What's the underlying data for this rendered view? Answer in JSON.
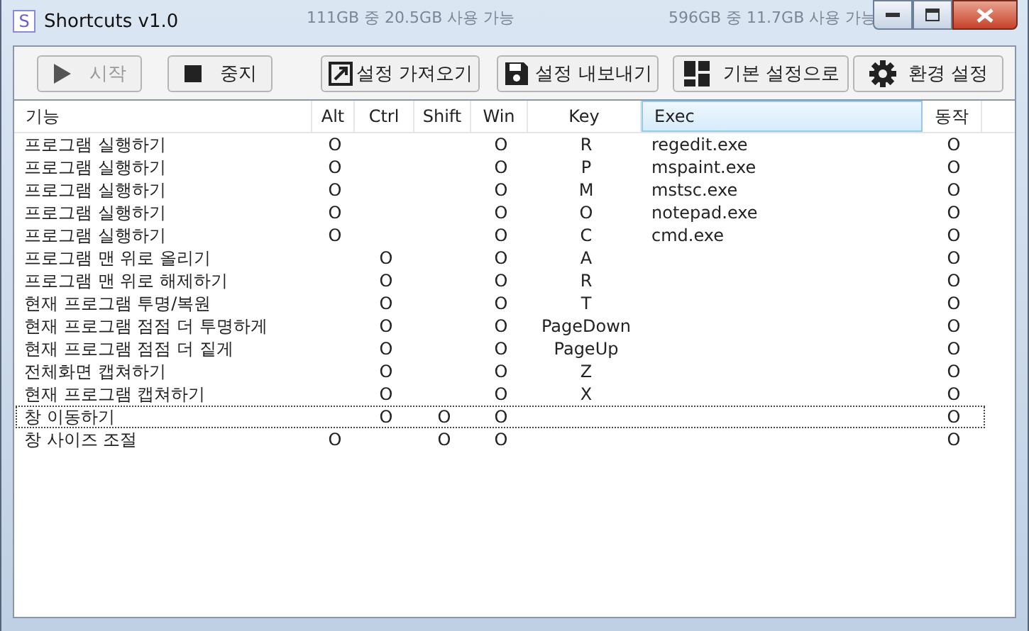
{
  "window": {
    "title": "Shortcuts v1.0",
    "icon_letter": "S"
  },
  "background_labels": [
    "111GB 중 20.5GB 사용 가능",
    "596GB 중 11.7GB 사용 가능"
  ],
  "toolbar": {
    "buttons": [
      {
        "label": "시작",
        "disabled": true
      },
      {
        "label": "중지",
        "disabled": false
      },
      {
        "label": "설정 가져오기",
        "disabled": false
      },
      {
        "label": "설정 내보내기",
        "disabled": false
      },
      {
        "label": "기본 설정으로",
        "disabled": false
      },
      {
        "label": "환경 설정",
        "disabled": false
      }
    ]
  },
  "table": {
    "columns": [
      {
        "label": "기능",
        "highlighted": false
      },
      {
        "label": "Alt",
        "highlighted": false
      },
      {
        "label": "Ctrl",
        "highlighted": false
      },
      {
        "label": "Shift",
        "highlighted": false
      },
      {
        "label": "Win",
        "highlighted": false
      },
      {
        "label": "Key",
        "highlighted": false
      },
      {
        "label": "Exec",
        "highlighted": true
      },
      {
        "label": "동작",
        "highlighted": false
      }
    ],
    "rows": [
      {
        "cells": [
          "프로그램 실행하기",
          "O",
          "",
          "",
          "O",
          "R",
          "regedit.exe",
          "O"
        ],
        "focused": false
      },
      {
        "cells": [
          "프로그램 실행하기",
          "O",
          "",
          "",
          "O",
          "P",
          "mspaint.exe",
          "O"
        ],
        "focused": false
      },
      {
        "cells": [
          "프로그램 실행하기",
          "O",
          "",
          "",
          "O",
          "M",
          "mstsc.exe",
          "O"
        ],
        "focused": false
      },
      {
        "cells": [
          "프로그램 실행하기",
          "O",
          "",
          "",
          "O",
          "O",
          "notepad.exe",
          "O"
        ],
        "focused": false
      },
      {
        "cells": [
          "프로그램 실행하기",
          "O",
          "",
          "",
          "O",
          "C",
          "cmd.exe",
          "O"
        ],
        "focused": false
      },
      {
        "cells": [
          "프로그램 맨 위로 올리기",
          "",
          "O",
          "",
          "O",
          "A",
          "",
          "O"
        ],
        "focused": false
      },
      {
        "cells": [
          "프로그램 맨 위로 해제하기",
          "",
          "O",
          "",
          "O",
          "R",
          "",
          "O"
        ],
        "focused": false
      },
      {
        "cells": [
          "현재 프로그램 투명/복원",
          "",
          "O",
          "",
          "O",
          "T",
          "",
          "O"
        ],
        "focused": false
      },
      {
        "cells": [
          "현재 프로그램 점점 더 투명하게",
          "",
          "O",
          "",
          "O",
          "PageDown",
          "",
          "O"
        ],
        "focused": false
      },
      {
        "cells": [
          "현재 프로그램 점점 더 짙게",
          "",
          "O",
          "",
          "O",
          "PageUp",
          "",
          "O"
        ],
        "focused": false
      },
      {
        "cells": [
          "전체화면 캡쳐하기",
          "",
          "O",
          "",
          "O",
          "Z",
          "",
          "O"
        ],
        "focused": false
      },
      {
        "cells": [
          "현재 프로그램 캡쳐하기",
          "",
          "O",
          "",
          "O",
          "X",
          "",
          "O"
        ],
        "focused": false
      },
      {
        "cells": [
          "창 이동하기",
          "",
          "O",
          "O",
          "O",
          "",
          "",
          "O"
        ],
        "focused": true
      },
      {
        "cells": [
          "창 사이즈 조절",
          "O",
          "",
          "O",
          "O",
          "",
          "",
          "O"
        ],
        "focused": false
      }
    ]
  }
}
